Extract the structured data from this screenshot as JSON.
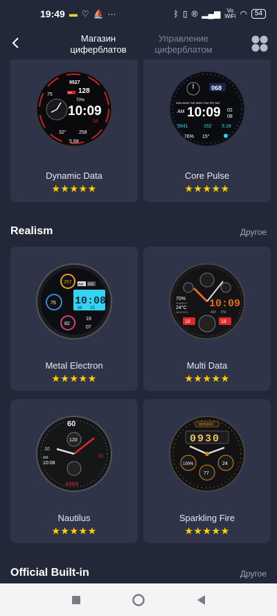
{
  "status_bar": {
    "time": "19:49",
    "network_label_top": "Vo",
    "network_label_bottom": "WiFi",
    "battery": "54"
  },
  "header": {
    "active_tab": "Магазин циферблатов",
    "active_tab_line1": "Магазин",
    "active_tab_line2": "циферблатов",
    "inactive_tab_line1": "Управление",
    "inactive_tab_line2": "циферблатом"
  },
  "cards": [
    {
      "name": "Dynamic Data",
      "rating": "★★★★★",
      "face": {
        "steps": "9527",
        "hr": "75",
        "calorie": "128",
        "power": "70%",
        "time": "10:09",
        "sec": "34",
        "ampm": "AM",
        "temp": "32°",
        "dist": "258",
        "bottom": "5.68"
      }
    },
    {
      "name": "Core Pulse",
      "rating": "★★★★★",
      "face": {
        "bpm": "068",
        "days": "SUN MON TUE WED THU FRI SAT",
        "ampm": "AM",
        "time": "10:09",
        "date1": "02",
        "date2": "08",
        "steps": "5641",
        "kcal": "152",
        "dist": "3.18",
        "power": "76%",
        "temp": "15°"
      }
    },
    {
      "name": "Metal Electron",
      "rating": "★★★★★",
      "face": {
        "top": "257",
        "left": "75",
        "bottom": "82",
        "am": "AM",
        "pm": "PM",
        "time": "10:08",
        "seconds": "56",
        "date": "15",
        "day": "SEC",
        "steps": "19",
        "drop": "07"
      }
    },
    {
      "name": "Multi Data",
      "rating": "★★★★★",
      "face": {
        "pct": "70%",
        "humidity": "HUMIDITY",
        "temp": "24°C",
        "weather": "WEATHER",
        "time": "10:09",
        "am": "AM",
        "pm": "PM",
        "d1": "18",
        "d2": "16"
      }
    },
    {
      "name": "Nautilus",
      "rating": "★★★★★",
      "face": {
        "top": "60",
        "left": "10",
        "right": "31",
        "sub": "120",
        "am": "AM",
        "time": "10:08",
        "bottom": "6000"
      }
    },
    {
      "name": "Sparkling Fire",
      "rating": "★★★★★",
      "face": {
        "day": "MONDAY",
        "digits": "0930",
        "pct": "100%",
        "mid": "77",
        "right": "24"
      }
    }
  ],
  "sections": [
    {
      "title": "Realism",
      "more": "Другое"
    },
    {
      "title": "Official Built-in",
      "more": "Другое"
    }
  ],
  "colors": {
    "background": "#232838",
    "card": "#2f3448",
    "star": "#ffd000",
    "accent_red": "#e02a2a",
    "accent_cyan": "#35d3f2"
  }
}
